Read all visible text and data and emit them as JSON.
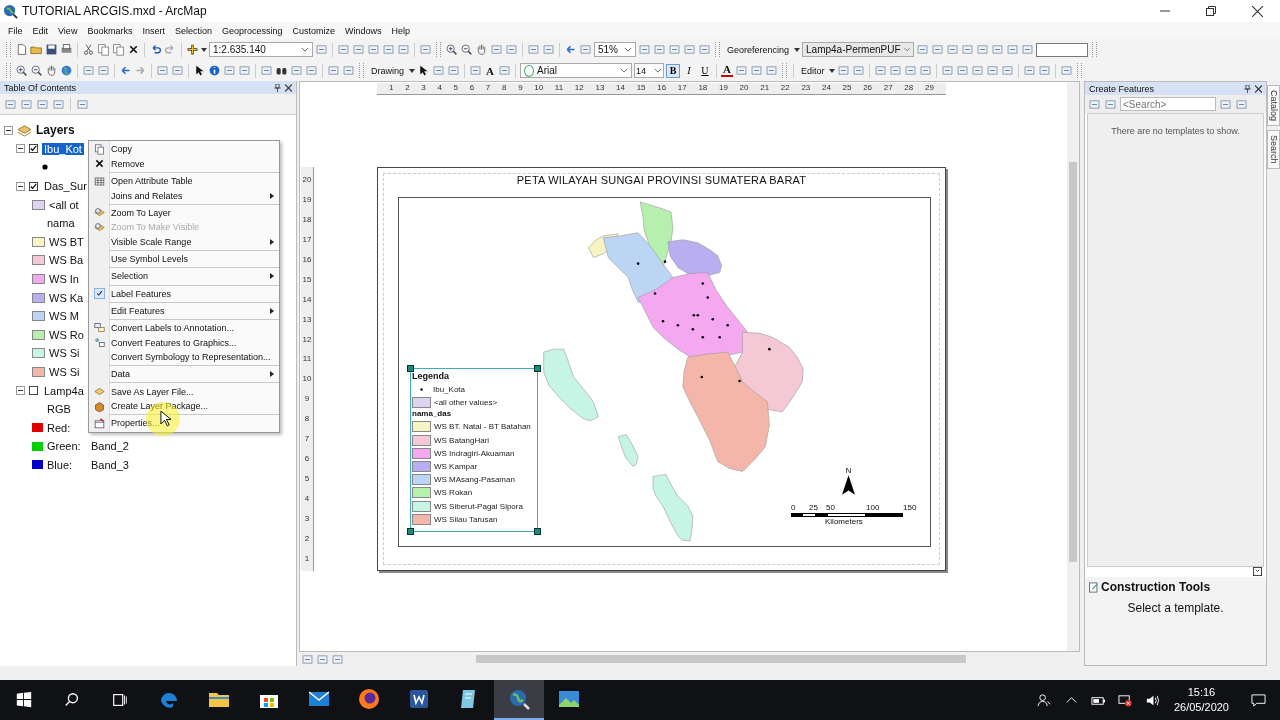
{
  "window": {
    "title": "TUTORIAL ARCGIS.mxd - ArcMap"
  },
  "menu_bar": [
    "File",
    "Edit",
    "View",
    "Bookmarks",
    "Insert",
    "Selection",
    "Geoprocessing",
    "Customize",
    "Windows",
    "Help"
  ],
  "toolbar": {
    "scale": "1:2.635.140",
    "zoom": "51%",
    "georeferencing": "Georeferencing",
    "georef_layer": "Lamp4a-PermenPUF",
    "drawing": "Drawing",
    "font": "Arial",
    "font_size": "14",
    "editor": "Editor",
    "format_buttons": [
      {
        "label": "B",
        "selected": true
      },
      {
        "label": "I",
        "selected": false
      },
      {
        "label": "U",
        "selected": false
      }
    ],
    "text_color_letter": "A",
    "drawing_text_letter": "A"
  },
  "toc": {
    "title": "Table Of Contents",
    "tree": [
      {
        "label": "Layers",
        "kind": "frame",
        "expanded": true,
        "children": [
          {
            "label": "Ibu_Kot",
            "kind": "layer",
            "checked": true,
            "selected": true,
            "expanded": true,
            "children": [
              {
                "kind": "point"
              }
            ]
          },
          {
            "label": "Das_Sur",
            "kind": "layer",
            "checked": true,
            "selected": false,
            "expanded": true,
            "children": [
              {
                "kind": "swatch",
                "label": "<all ot",
                "color": "#dcd4f2"
              },
              {
                "kind": "heading",
                "label": "nama"
              },
              {
                "kind": "swatch",
                "label": "WS BT",
                "color": "#f7f4c4"
              },
              {
                "kind": "swatch",
                "label": "WS Ba",
                "color": "#f5c8d6"
              },
              {
                "kind": "swatch",
                "label": "WS In",
                "color": "#f3a8ef"
              },
              {
                "kind": "swatch",
                "label": "WS Ka",
                "color": "#b8aef0"
              },
              {
                "kind": "swatch",
                "label": "WS M",
                "color": "#bcd5f5"
              },
              {
                "kind": "swatch",
                "label": "WS Ro",
                "color": "#b6efae"
              },
              {
                "kind": "swatch",
                "label": "WS Si",
                "color": "#c6f5e6"
              },
              {
                "kind": "swatch",
                "label": "WS Si",
                "color": "#f4b6a8"
              }
            ]
          },
          {
            "label": "Lamp4a",
            "kind": "layer",
            "checked": false,
            "selected": false,
            "expanded": true,
            "children": [
              {
                "kind": "heading",
                "label": "RGB"
              },
              {
                "kind": "band",
                "label": "Red:",
                "color": "#e00000"
              },
              {
                "kind": "band",
                "label": "Green:",
                "value": "Band_2",
                "color": "#00d000"
              },
              {
                "kind": "band",
                "label": "Blue:",
                "value": "Band_3",
                "color": "#0000c8"
              }
            ]
          }
        ]
      }
    ]
  },
  "context_menu": [
    {
      "label": "Copy",
      "kind": "copy",
      "disabled": false,
      "checked": false,
      "submenu": false,
      "divider_above": false
    },
    {
      "label": "Remove",
      "kind": "remove",
      "disabled": false,
      "checked": false,
      "submenu": false,
      "divider_above": false
    },
    {
      "label": "Open Attribute Table",
      "kind": "table",
      "disabled": false,
      "checked": false,
      "submenu": false,
      "divider_above": true
    },
    {
      "label": "Joins and Relates",
      "disabled": false,
      "checked": false,
      "submenu": true,
      "divider_above": false
    },
    {
      "label": "Zoom To Layer",
      "kind": "zoom",
      "disabled": false,
      "checked": false,
      "submenu": false,
      "divider_above": true
    },
    {
      "label": "Zoom To Make Visible",
      "kind": "zoom",
      "disabled": true,
      "checked": false,
      "submenu": false,
      "divider_above": false
    },
    {
      "label": "Visible Scale Range",
      "disabled": false,
      "checked": false,
      "submenu": true,
      "divider_above": false
    },
    {
      "label": "Use Symbol Levels",
      "disabled": false,
      "checked": false,
      "submenu": false,
      "divider_above": true
    },
    {
      "label": "Selection",
      "disabled": false,
      "checked": false,
      "submenu": true,
      "divider_above": true
    },
    {
      "label": "Label Features",
      "disabled": false,
      "checked": true,
      "submenu": false,
      "divider_above": true
    },
    {
      "label": "Edit Features",
      "disabled": false,
      "checked": false,
      "submenu": true,
      "divider_above": true
    },
    {
      "label": "Convert Labels to Annotation...",
      "kind": "convert",
      "disabled": false,
      "checked": false,
      "submenu": false,
      "divider_above": true
    },
    {
      "label": "Convert Features to Graphics...",
      "kind": "graphics",
      "disabled": false,
      "checked": false,
      "submenu": false,
      "divider_above": false
    },
    {
      "label": "Convert Symbology to Representation...",
      "disabled": false,
      "checked": false,
      "submenu": false,
      "divider_above": false
    },
    {
      "label": "Data",
      "disabled": false,
      "checked": false,
      "submenu": true,
      "divider_above": true
    },
    {
      "label": "Save As Layer File...",
      "kind": "layer",
      "disabled": false,
      "checked": false,
      "submenu": false,
      "divider_above": true
    },
    {
      "label": "Create Layer Package...",
      "kind": "package",
      "disabled": false,
      "checked": false,
      "submenu": false,
      "divider_above": false
    },
    {
      "label": "Properties...",
      "kind": "properties",
      "disabled": false,
      "checked": false,
      "submenu": false,
      "divider_above": true
    }
  ],
  "ruler": {
    "horizontal": [
      "1",
      "2",
      "3",
      "4",
      "5",
      "6",
      "7",
      "8",
      "9",
      "10",
      "11",
      "12",
      "13",
      "14",
      "15",
      "16",
      "17",
      "18",
      "19",
      "20",
      "21",
      "22",
      "23",
      "24",
      "25",
      "26",
      "27",
      "28",
      "29"
    ],
    "vertical": [
      "20",
      "19",
      "18",
      "17",
      "16",
      "15",
      "14",
      "13",
      "12",
      "11",
      "10",
      "9",
      "8",
      "7",
      "6",
      "5",
      "4",
      "3",
      "2",
      "1"
    ]
  },
  "map_layout": {
    "title": "PETA WILAYAH SUNGAI PROVINSI SUMATERA BARAT",
    "legend": {
      "title": "Legenda",
      "selected": true,
      "items": [
        {
          "kind": "point",
          "label": "Ibu_Kota"
        },
        {
          "kind": "swatch",
          "label": "<all other values>",
          "color": "#dcd4f2"
        },
        {
          "kind": "heading",
          "label": "nama_das"
        },
        {
          "kind": "swatch",
          "label": "WS BT. Natal - BT Batahan",
          "color": "#f7f4c4"
        },
        {
          "kind": "swatch",
          "label": "WS BatangHari",
          "color": "#f5c8d6"
        },
        {
          "kind": "swatch",
          "label": "WS Indragiri-Akuaman",
          "color": "#f3a8ef"
        },
        {
          "kind": "swatch",
          "label": "WS Kampar",
          "color": "#b8aef0"
        },
        {
          "kind": "swatch",
          "label": "WS MAsang-Pasaman",
          "color": "#bcd5f5"
        },
        {
          "kind": "swatch",
          "label": "WS Rokan",
          "color": "#b6efae"
        },
        {
          "kind": "swatch",
          "label": "WS Siberut-Pagai Sipora",
          "color": "#c6f5e6"
        },
        {
          "kind": "swatch",
          "label": "WS Silau Tarusan",
          "color": "#f4b6a8"
        }
      ]
    },
    "north": "N",
    "scale_labels": [
      "0",
      "25",
      "50",
      "100",
      "150"
    ],
    "scale_unit": "Kilometers"
  },
  "create_features": {
    "title": "Create Features",
    "search_placeholder": "<Search>",
    "empty_message": "There are no templates to show."
  },
  "construction_tools": {
    "title": "Construction Tools",
    "message": "Select a template."
  },
  "side_tabs": [
    "Catalog",
    "Search"
  ],
  "taskbar": {
    "apps": [
      {
        "kind": "edge",
        "selected": false
      },
      {
        "kind": "explorer",
        "selected": false
      },
      {
        "kind": "store",
        "selected": false
      },
      {
        "kind": "mail",
        "selected": false
      },
      {
        "kind": "firefox",
        "selected": false
      },
      {
        "kind": "word",
        "selected": false
      },
      {
        "kind": "notes",
        "selected": false
      },
      {
        "kind": "arcmap",
        "selected": true
      },
      {
        "kind": "photos",
        "selected": false
      }
    ],
    "time": "15:16",
    "date": "26/05/2020"
  }
}
